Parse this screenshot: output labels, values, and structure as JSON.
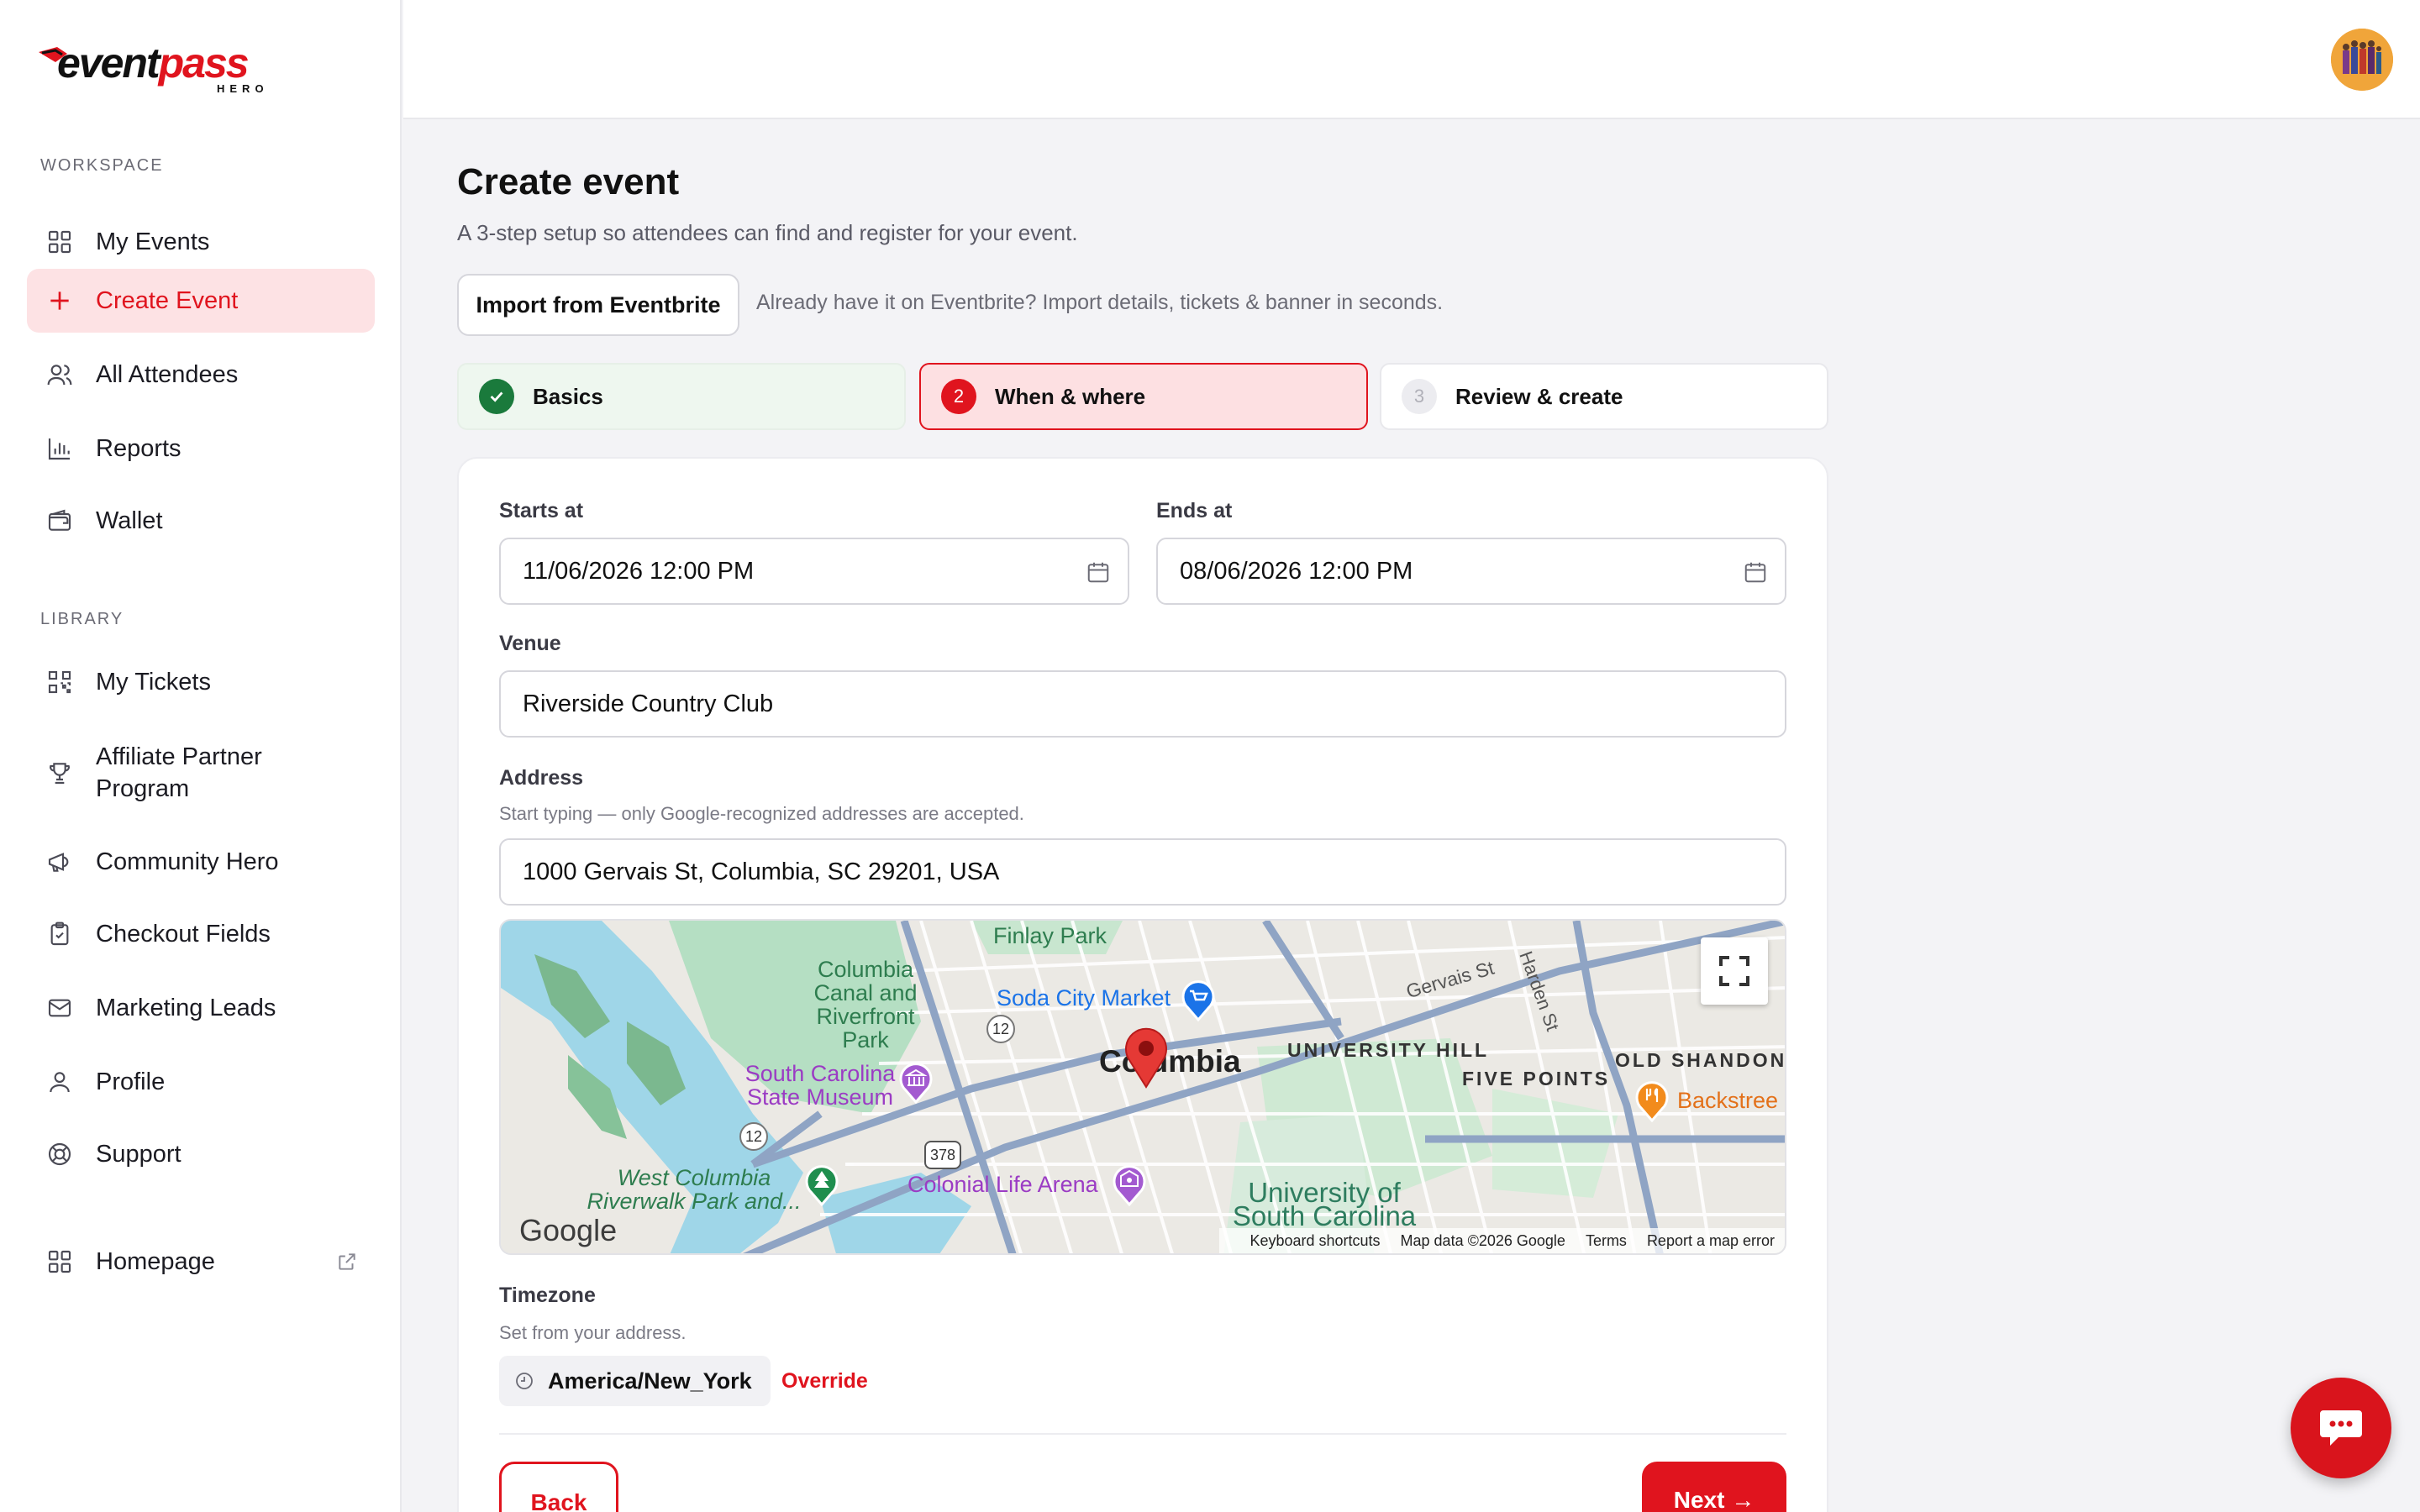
{
  "brand": {
    "logo_main_a": "event",
    "logo_main_b": "pass",
    "logo_sub": "HERO",
    "accent": "#e0141e"
  },
  "sidebar": {
    "workspace_label": "WORKSPACE",
    "library_label": "LIBRARY",
    "workspace_items": [
      {
        "label": "My Events",
        "icon": "grid-icon"
      },
      {
        "label": "Create Event",
        "icon": "plus-icon",
        "active": true
      },
      {
        "label": "All Attendees",
        "icon": "users-icon"
      },
      {
        "label": "Reports",
        "icon": "bar-chart-icon"
      },
      {
        "label": "Wallet",
        "icon": "wallet-icon"
      }
    ],
    "library_items": [
      {
        "label": "My Tickets",
        "icon": "qr-code-icon"
      },
      {
        "label": "Affiliate Partner Program",
        "icon": "trophy-icon"
      },
      {
        "label": "Community Hero",
        "icon": "megaphone-icon"
      },
      {
        "label": "Checkout Fields",
        "icon": "clipboard-check-icon"
      },
      {
        "label": "Marketing Leads",
        "icon": "mail-icon"
      },
      {
        "label": "Profile",
        "icon": "user-icon"
      },
      {
        "label": "Support",
        "icon": "lifebuoy-icon"
      }
    ],
    "homepage": {
      "label": "Homepage",
      "icon": "grid-icon",
      "external_icon": "external-link-icon"
    }
  },
  "header": {
    "avatar": "user-avatar"
  },
  "page": {
    "title": "Create event",
    "subtitle": "A 3-step setup so attendees can find and register for your event.",
    "import_button": "Import from Eventbrite",
    "import_hint": "Already have it on Eventbrite? Import details, tickets & banner in seconds."
  },
  "steps": [
    {
      "number": "✓",
      "label": "Basics",
      "state": "complete"
    },
    {
      "number": "2",
      "label": "When & where",
      "state": "current"
    },
    {
      "number": "3",
      "label": "Review & create",
      "state": "upcoming"
    }
  ],
  "form": {
    "starts_label": "Starts at",
    "starts_value": "11/06/2026 12:00 PM",
    "ends_label": "Ends at",
    "ends_value": "08/06/2026 12:00 PM",
    "venue_label": "Venue",
    "venue_value": "Riverside Country Club",
    "address_label": "Address",
    "address_help": "Start typing — only Google-recognized addresses are accepted.",
    "address_value": "1000 Gervais St, Columbia, SC 29201, USA",
    "timezone_label": "Timezone",
    "timezone_help": "Set from your address.",
    "timezone_value": "America/New_York",
    "override_label": "Override"
  },
  "map": {
    "labels": {
      "finlay": "Finlay Park",
      "canal_1": "Columbia",
      "canal_2": "Canal and",
      "canal_3": "Riverfront",
      "canal_4": "Park",
      "soda": "Soda City Market",
      "columbia": "Columbia",
      "university_hill": "UNIVERSITY HILL",
      "five_points": "FIVE POINTS",
      "old_shandon": "OLD SHANDON",
      "backstreet": "Backstree",
      "museum_1": "South Carolina",
      "museum_2": "State Museum",
      "west_columbia_1": "West Columbia",
      "west_columbia_2": "Riverwalk Park and...",
      "colonial": "Colonial Life Arena",
      "univ_1": "University of",
      "univ_2": "South Carolina",
      "gervais": "Gervais St",
      "harden": "Harden St",
      "route_12a": "12",
      "route_12b": "12",
      "route_378": "378"
    },
    "google": "Google",
    "footer": [
      "Keyboard shortcuts",
      "Map data ©2026 Google",
      "Terms",
      "Report a map error"
    ]
  },
  "actions": {
    "back": "Back",
    "next": "Next →"
  },
  "chat": {
    "icon": "chat-bubble-icon"
  }
}
